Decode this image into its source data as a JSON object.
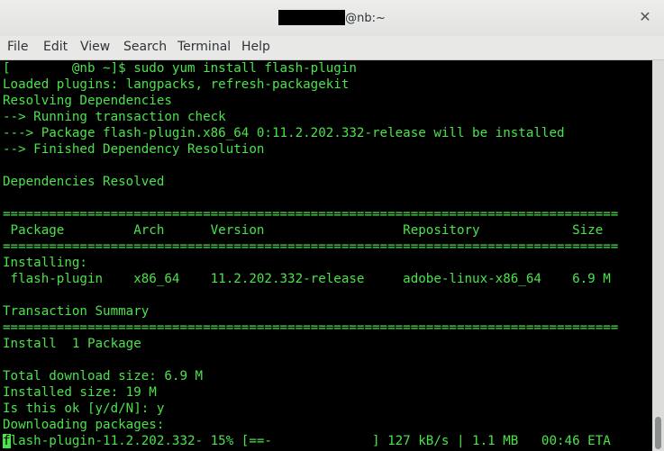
{
  "window": {
    "title_suffix": "@nb:~",
    "close_glyph": "✕"
  },
  "menu": {
    "file": "File",
    "edit": "Edit",
    "view": "View",
    "search": "Search",
    "terminal": "Terminal",
    "help": "Help"
  },
  "terminal": {
    "lines": [
      "[        @nb ~]$ sudo yum install flash-plugin",
      "Loaded plugins: langpacks, refresh-packagekit",
      "Resolving Dependencies",
      "--> Running transaction check",
      "---> Package flash-plugin.x86_64 0:11.2.202.332-release will be installed",
      "--> Finished Dependency Resolution",
      "",
      "Dependencies Resolved",
      "",
      "================================================================================",
      " Package         Arch      Version                  Repository            Size",
      "================================================================================",
      "Installing:",
      " flash-plugin    x86_64    11.2.202.332-release     adobe-linux-x86_64    6.9 M",
      "",
      "Transaction Summary",
      "================================================================================",
      "Install  1 Package",
      "",
      "Total download size: 6.9 M",
      "Installed size: 19 M",
      "Is this ok [y/d/N]: y",
      "Downloading packages:"
    ],
    "progress_cursor_char": "f",
    "progress_line": "lash-plugin-11.2.202.332- 15% [==-             ] 127 kB/s | 1.1 MB   00:46 ETA"
  }
}
